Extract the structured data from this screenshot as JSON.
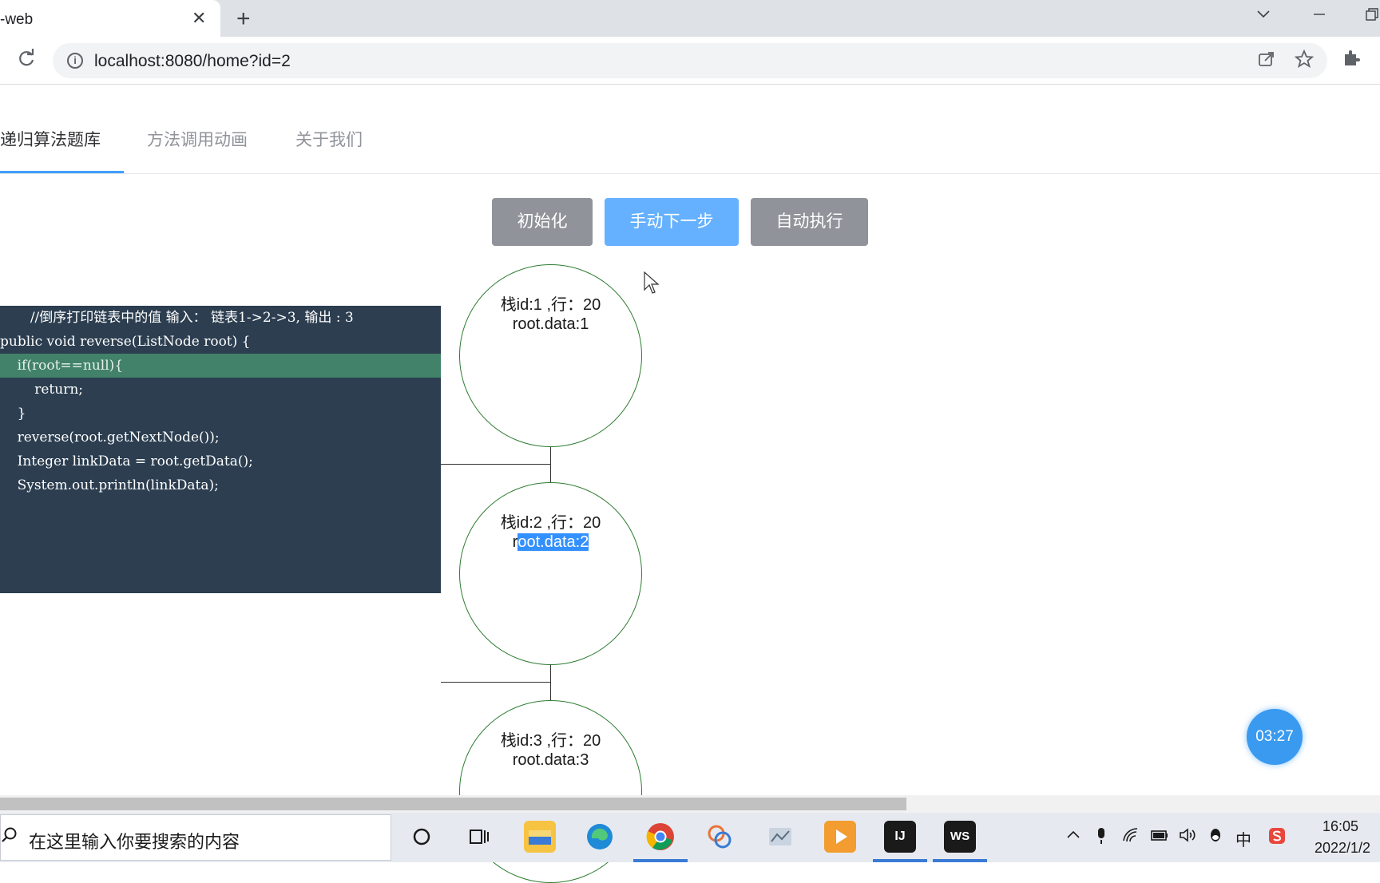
{
  "browser": {
    "tab_title": "-web",
    "tab_close": "✕",
    "new_tab": "+",
    "url": "localhost:8080/home?id=2",
    "dropdown_icon": "chevron-down-icon",
    "minimize_icon": "minimize-icon",
    "restore_icon": "restore-icon"
  },
  "nav": {
    "items": [
      {
        "label": "递归算法题库"
      },
      {
        "label": "方法调用动画"
      },
      {
        "label": "关于我们"
      }
    ]
  },
  "controls": {
    "init": "初始化",
    "next": "手动下一步",
    "auto": "自动执行"
  },
  "code": {
    "lines": [
      "       //倒序打印链表中的值 输入： 链表1->2->3, 输出 : 3",
      "public void reverse(ListNode root) {",
      "    if(root==null){",
      "        return;",
      "    }",
      "    reverse(root.getNextNode());",
      "    Integer linkData = root.getData();",
      "    System.out.println(linkData);"
    ],
    "highlight_line": 2
  },
  "stack": [
    {
      "label": "栈id:1 ,行：20",
      "data": "root.data:1"
    },
    {
      "label": "栈id:2 ,行：20",
      "data_prefix": "r",
      "data_selected": "oot.data:2"
    },
    {
      "label": "栈id:3 ,行：20",
      "data": "root.data:3"
    }
  ],
  "timer": "03:27",
  "taskbar": {
    "search_placeholder": "在这里输入你要搜索的内容",
    "apps": [
      "cortana-icon",
      "task-view-icon",
      "file-explorer-icon",
      "edge-icon",
      "chrome-icon",
      "app-icon",
      "app-icon",
      "media-icon",
      "intellij-icon",
      "webstorm-icon"
    ],
    "ime": "中",
    "time": "16:05",
    "date": "2022/1/2"
  },
  "colors": {
    "code_bg": "#2c3e50",
    "code_highlight": "#42826a",
    "primary": "#409eff",
    "button_grey": "#909399",
    "node_border": "#2e7d32"
  }
}
